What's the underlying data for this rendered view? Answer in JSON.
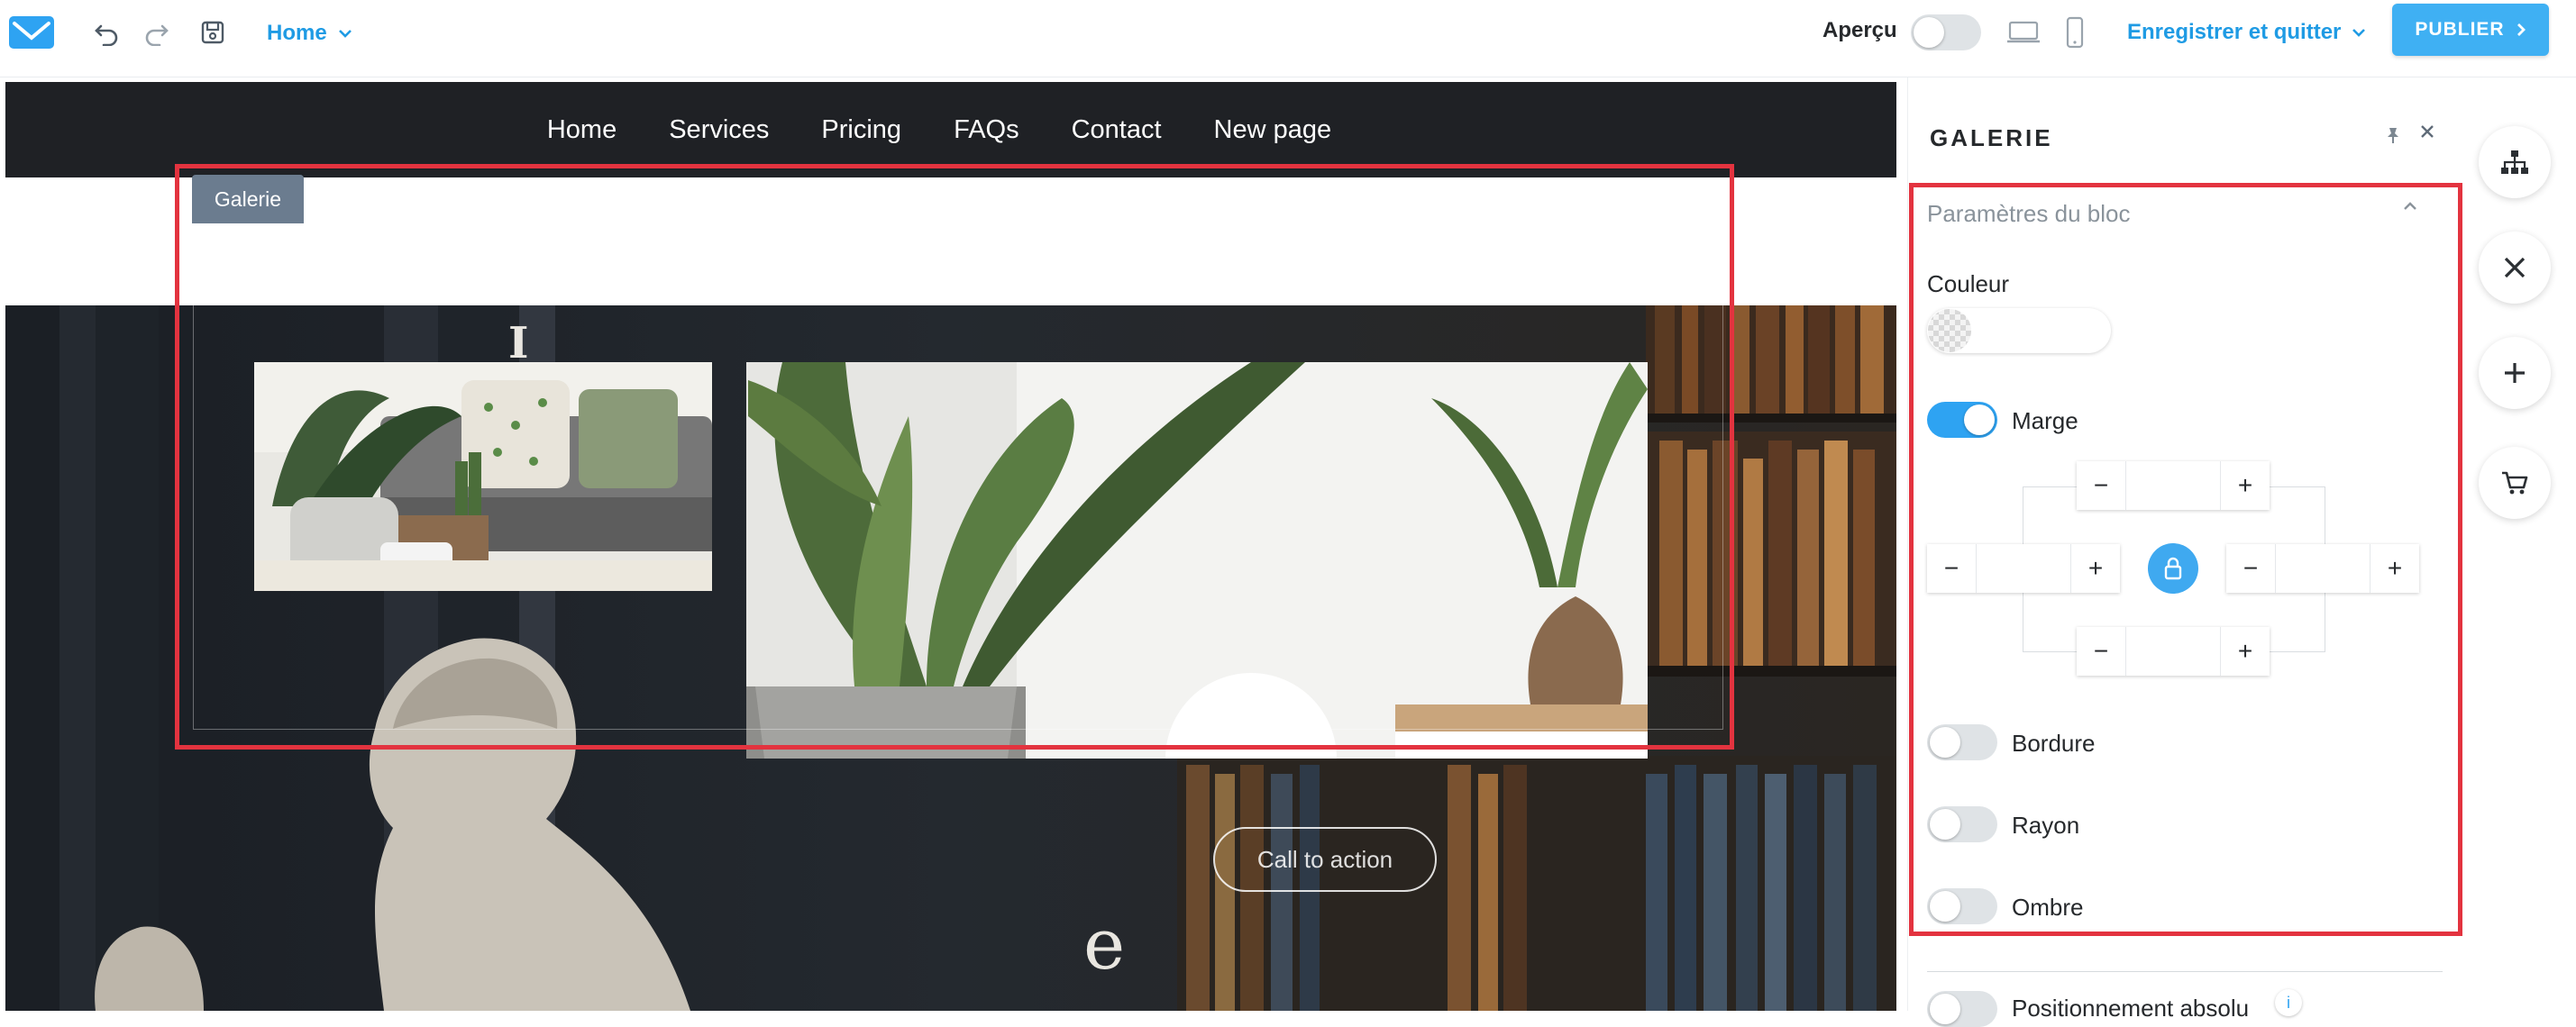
{
  "toolbar": {
    "page_select": "Home",
    "preview_label": "Aperçu",
    "save_quit_label": "Enregistrer et quitter",
    "publish_label": "PUBLIER"
  },
  "site": {
    "nav": [
      "Home",
      "Services",
      "Pricing",
      "FAQs",
      "Contact",
      "New page"
    ],
    "cta_label": "Call to action"
  },
  "gallery": {
    "tag": "Galerie"
  },
  "panel": {
    "title": "GALERIE",
    "section_title": "Paramètres du bloc",
    "color_label": "Couleur",
    "margin_label": "Marge",
    "margin_enabled": true,
    "border_label": "Bordure",
    "border_enabled": false,
    "radius_label": "Rayon",
    "radius_enabled": false,
    "shadow_label": "Ombre",
    "shadow_enabled": false,
    "absolute_label": "Positionnement absolu"
  },
  "colors": {
    "accent": "#2ea3f2",
    "selection": "#e3333f",
    "nav_bg": "#1f2125"
  }
}
